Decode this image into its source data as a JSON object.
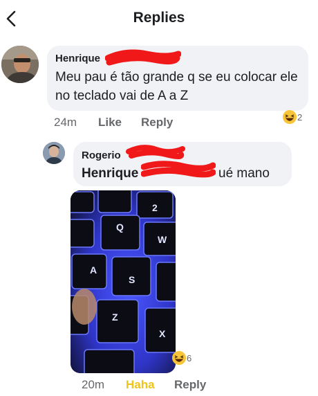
{
  "header": {
    "title": "Replies",
    "back_icon": "chevron-left-icon"
  },
  "comment": {
    "author": "Henrique",
    "text": "Meu pau é tão grande q se eu colocar ele no teclado vai de A a Z",
    "time": "24m",
    "like_label": "Like",
    "reply_label": "Reply",
    "reaction_icon": "haha-emoji-icon",
    "reaction_count": "2"
  },
  "reply": {
    "author": "Rogerio",
    "mention": "Henrique",
    "text": "ué mano",
    "time": "20m",
    "reaction_label": "Haha",
    "reply_label": "Reply",
    "reaction_icon": "haha-emoji-icon",
    "reaction_count": "6",
    "photo": {
      "keys": [
        "2",
        "Q",
        "W",
        "A",
        "S",
        "Z",
        "X"
      ],
      "backlight_color": "#3b47ff"
    }
  },
  "colors": {
    "redaction": "#f01818",
    "haha_active": "#f0c419",
    "bubble": "#f0f2f5",
    "meta": "#65676b"
  }
}
